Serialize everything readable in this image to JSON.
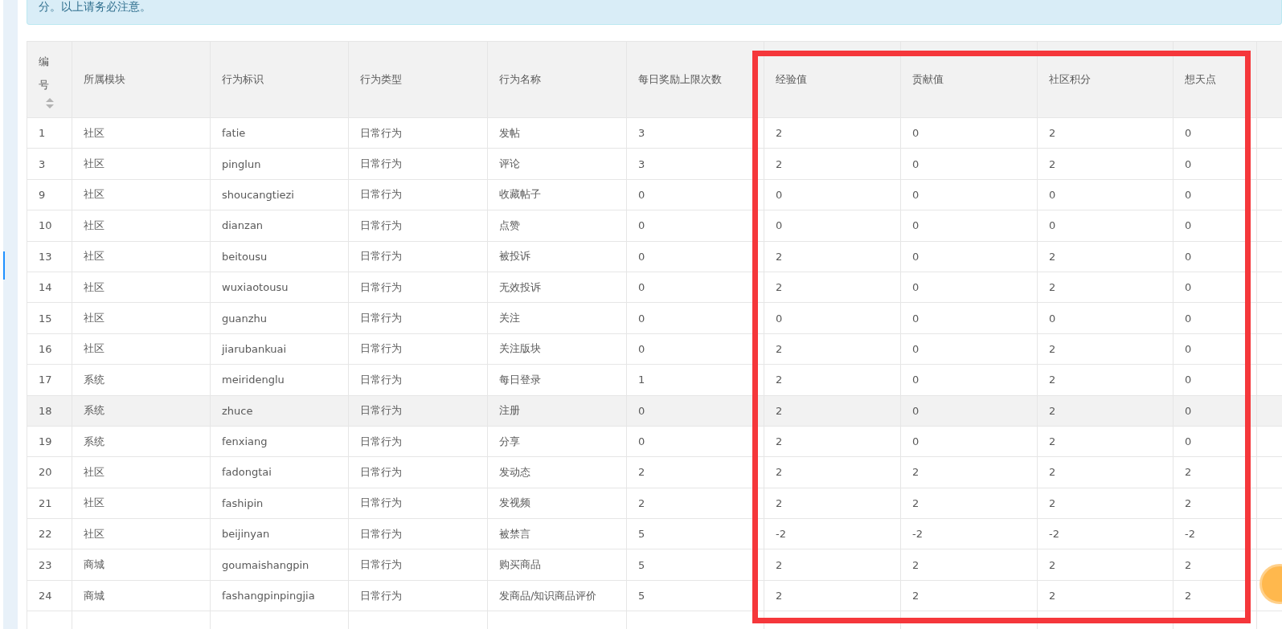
{
  "notice": {
    "text": "分。以上请务必注意。"
  },
  "table": {
    "columns": [
      {
        "label": "编号",
        "sortable": true,
        "highlighted": false
      },
      {
        "label": "所属模块",
        "sortable": false,
        "highlighted": false
      },
      {
        "label": "行为标识",
        "sortable": false,
        "highlighted": false
      },
      {
        "label": "行为类型",
        "sortable": false,
        "highlighted": false
      },
      {
        "label": "行为名称",
        "sortable": false,
        "highlighted": false
      },
      {
        "label": "每日奖励上限次数",
        "sortable": false,
        "highlighted": false
      },
      {
        "label": "经验值",
        "sortable": false,
        "highlighted": true
      },
      {
        "label": "贡献值",
        "sortable": false,
        "highlighted": true
      },
      {
        "label": "社区积分",
        "sortable": false,
        "highlighted": true
      },
      {
        "label": "想天点",
        "sortable": false,
        "highlighted": true
      }
    ],
    "rows": [
      {
        "selected": false,
        "cells": [
          "1",
          "社区",
          "fatie",
          "日常行为",
          "发帖",
          "3",
          "2",
          "0",
          "2",
          "0"
        ]
      },
      {
        "selected": false,
        "cells": [
          "3",
          "社区",
          "pinglun",
          "日常行为",
          "评论",
          "3",
          "2",
          "0",
          "2",
          "0"
        ]
      },
      {
        "selected": false,
        "cells": [
          "9",
          "社区",
          "shoucangtiezi",
          "日常行为",
          "收藏帖子",
          "0",
          "0",
          "0",
          "0",
          "0"
        ]
      },
      {
        "selected": false,
        "cells": [
          "10",
          "社区",
          "dianzan",
          "日常行为",
          "点赞",
          "0",
          "0",
          "0",
          "0",
          "0"
        ]
      },
      {
        "selected": false,
        "cells": [
          "13",
          "社区",
          "beitousu",
          "日常行为",
          "被投诉",
          "0",
          "2",
          "0",
          "2",
          "0"
        ]
      },
      {
        "selected": false,
        "cells": [
          "14",
          "社区",
          "wuxiaotousu",
          "日常行为",
          "无效投诉",
          "0",
          "2",
          "0",
          "2",
          "0"
        ]
      },
      {
        "selected": false,
        "cells": [
          "15",
          "社区",
          "guanzhu",
          "日常行为",
          "关注",
          "0",
          "0",
          "0",
          "0",
          "0"
        ]
      },
      {
        "selected": false,
        "cells": [
          "16",
          "社区",
          "jiarubankuai",
          "日常行为",
          "关注版块",
          "0",
          "2",
          "0",
          "2",
          "0"
        ]
      },
      {
        "selected": false,
        "cells": [
          "17",
          "系统",
          "meiridenglu",
          "日常行为",
          "每日登录",
          "1",
          "2",
          "0",
          "2",
          "0"
        ]
      },
      {
        "selected": true,
        "cells": [
          "18",
          "系统",
          "zhuce",
          "日常行为",
          "注册",
          "0",
          "2",
          "0",
          "2",
          "0"
        ]
      },
      {
        "selected": false,
        "cells": [
          "19",
          "系统",
          "fenxiang",
          "日常行为",
          "分享",
          "0",
          "2",
          "0",
          "2",
          "0"
        ]
      },
      {
        "selected": false,
        "cells": [
          "20",
          "社区",
          "fadongtai",
          "日常行为",
          "发动态",
          "2",
          "2",
          "2",
          "2",
          "2"
        ]
      },
      {
        "selected": false,
        "cells": [
          "21",
          "社区",
          "fashipin",
          "日常行为",
          "发视频",
          "2",
          "2",
          "2",
          "2",
          "2"
        ]
      },
      {
        "selected": false,
        "cells": [
          "22",
          "社区",
          "beijinyan",
          "日常行为",
          "被禁言",
          "5",
          "-2",
          "-2",
          "-2",
          "-2"
        ]
      },
      {
        "selected": false,
        "cells": [
          "23",
          "商城",
          "goumaishangpin",
          "日常行为",
          "购买商品",
          "5",
          "2",
          "2",
          "2",
          "2"
        ]
      },
      {
        "selected": false,
        "cells": [
          "24",
          "商城",
          "fashangpinpingjia",
          "日常行为",
          "发商品/知识商品评价",
          "5",
          "2",
          "2",
          "2",
          "2"
        ]
      }
    ]
  }
}
